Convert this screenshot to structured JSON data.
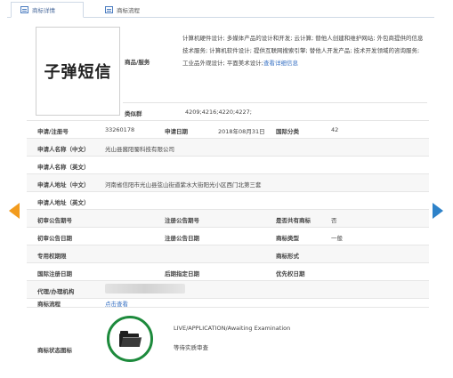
{
  "tabs": [
    {
      "label": "商标详情",
      "icon": "list-icon",
      "active": true
    },
    {
      "label": "商标流程",
      "icon": "grid-icon",
      "active": false
    }
  ],
  "trademark": {
    "name": "子弹短信",
    "goods_label": "商品/服务",
    "goods_text": "计算机硬件设计; 多媒体产品的设计和开发; 云计算; 替他人创建和维护网站; 外包商提供的信息技术服务; 计算机软件设计; 提供互联网搜索引擎; 替他人开发产品; 技术开发领域的咨询服务; 工业品外观设计; 平面美术设计;",
    "goods_link": "查看详细信息",
    "class_label": "类似群",
    "class_value": "4209;4216;4220;4227;"
  },
  "fields": {
    "reg_no_label": "申请/注册号",
    "reg_no": "33260178",
    "apply_date_label": "申请日期",
    "apply_date": "2018年08月31日",
    "intl_class_label": "国际分类",
    "intl_class": "42",
    "applicant_cn_label": "申请人名称（中文）",
    "applicant_cn": "光山县酱阳蜀科技有限公司",
    "applicant_en_label": "申请人名称（英文）",
    "address_cn_label": "申请人地址（中文）",
    "address_cn": "河南省信阳市光山县弦山街道紫水大街阳光小区西门北第三套",
    "address_en_label": "申请人地址（英文）",
    "prelim_no_label": "初审公告期号",
    "reg_pub_no_label": "注册公告期号",
    "shared_label": "是否共有商标",
    "shared": "否",
    "prelim_date_label": "初审公告日期",
    "reg_pub_date_label": "注册公告日期",
    "tm_type_label": "商标类型",
    "tm_type": "一般",
    "exclusive_label": "专用权期限",
    "tm_form_label": "商标形式",
    "intl_reg_date_label": "国际注册日期",
    "later_date_label": "后期指定日期",
    "priority_date_label": "优先权日期",
    "agent_label": "代理/办理机构",
    "flow_label": "商标流程",
    "flow_link": "点击查看"
  },
  "status": {
    "label": "商标状态图标",
    "en": "LIVE/APPLICATION/Awaiting Examination",
    "cn": "等待实质审查",
    "icon": "folder-icon",
    "ring_color": "#1d8a3c"
  },
  "nav": {
    "prev_icon": "arrow-left-icon",
    "next_icon": "arrow-right-icon",
    "prev_color": "#f29b1d",
    "next_color": "#2e82c9"
  }
}
